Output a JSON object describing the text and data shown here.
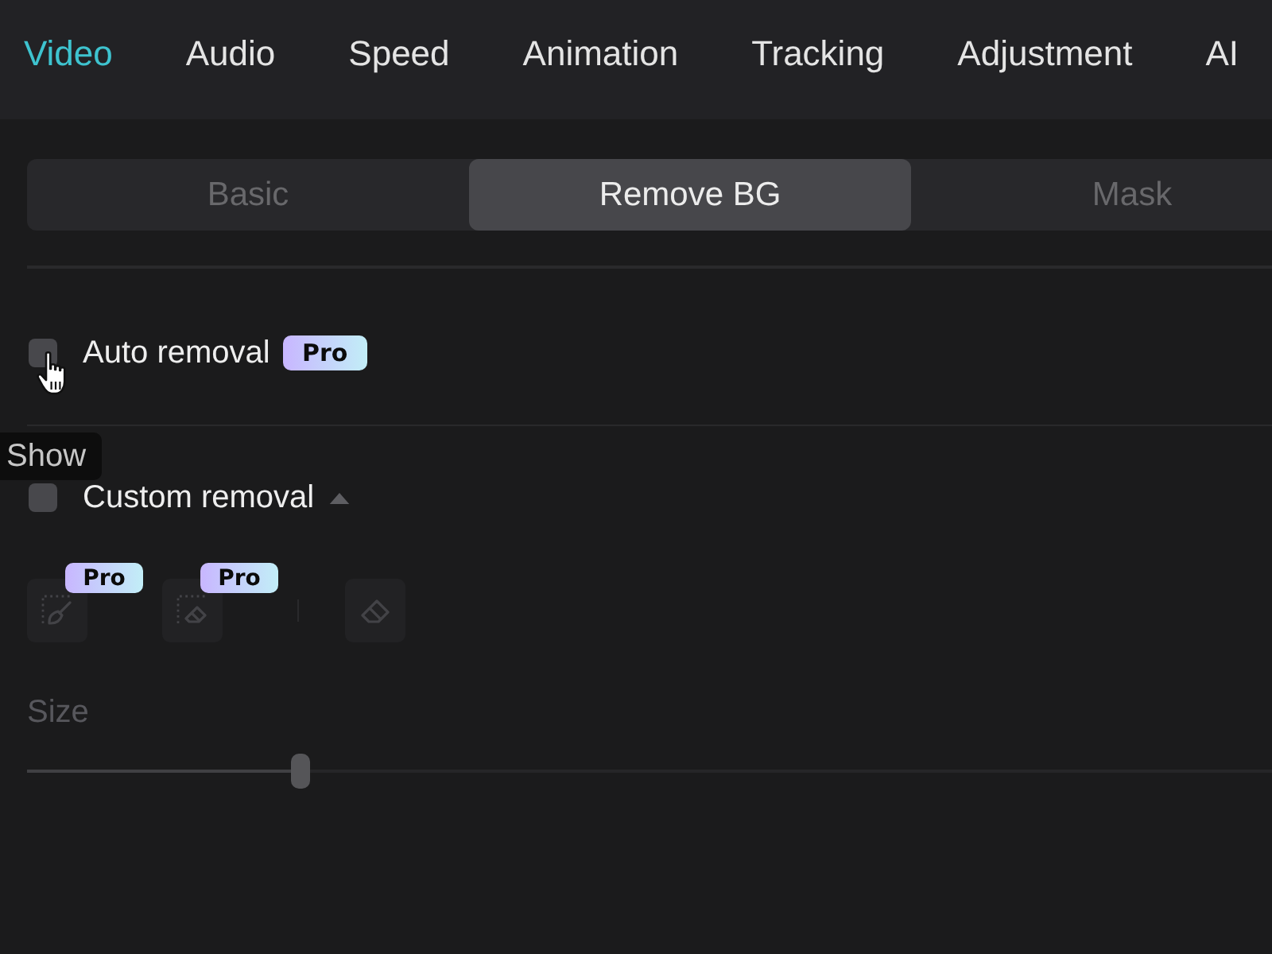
{
  "tabs": [
    {
      "label": "Video",
      "selected": true
    },
    {
      "label": "Audio",
      "selected": false
    },
    {
      "label": "Speed",
      "selected": false
    },
    {
      "label": "Animation",
      "selected": false
    },
    {
      "label": "Tracking",
      "selected": false
    },
    {
      "label": "Adjustment",
      "selected": false
    },
    {
      "label": "AI",
      "selected": false
    }
  ],
  "subtabs": [
    {
      "label": "Basic",
      "selected": false
    },
    {
      "label": "Remove BG",
      "selected": true
    },
    {
      "label": "Mask",
      "selected": false
    }
  ],
  "auto_removal": {
    "label": "Auto removal",
    "checked": false,
    "badge": "Pro"
  },
  "tooltip": {
    "text": "Show"
  },
  "custom_removal": {
    "label": "Custom removal",
    "checked": false,
    "expanded": true,
    "tools": [
      {
        "kind": "brush",
        "badge": "Pro",
        "disabled": true
      },
      {
        "kind": "area-eraser",
        "badge": "Pro",
        "disabled": true
      },
      {
        "kind": "eraser",
        "disabled": true
      }
    ],
    "size": {
      "label": "Size",
      "level": 0.22,
      "disabled": true
    }
  }
}
